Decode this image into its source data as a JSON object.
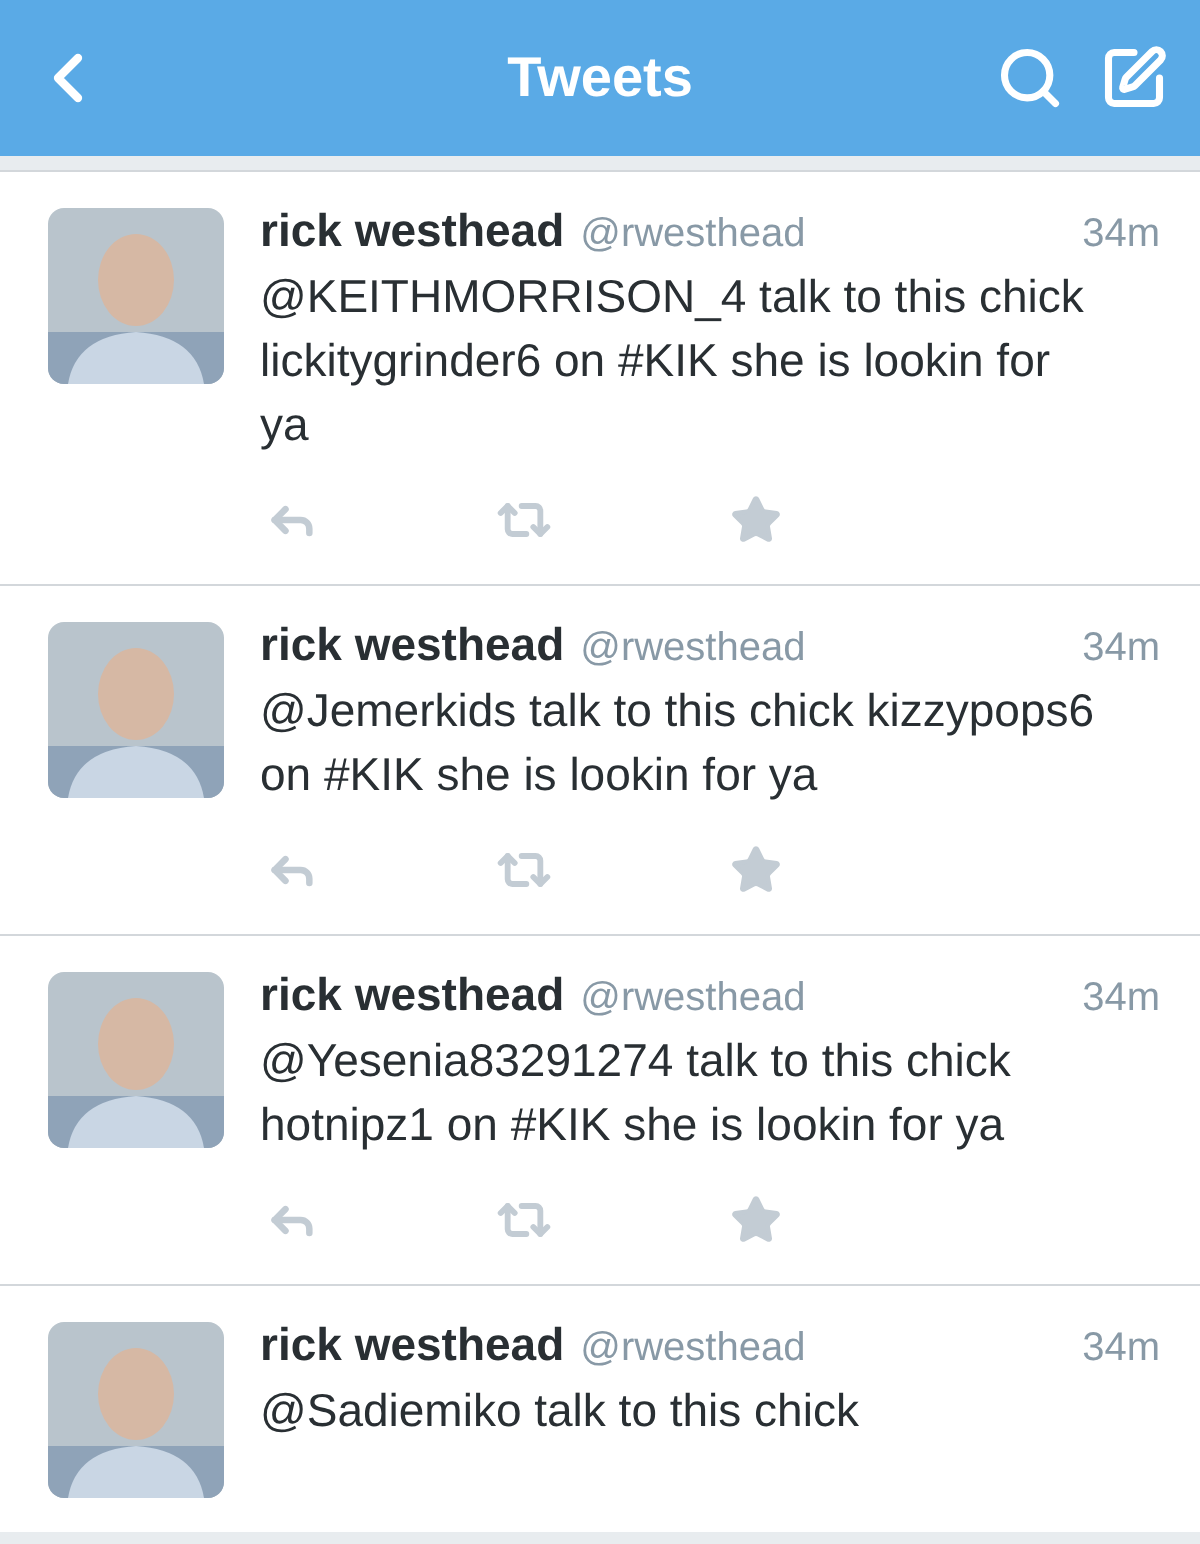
{
  "header": {
    "title": "Tweets"
  },
  "tweets": [
    {
      "name": "rick westhead",
      "handle": "@rwesthead",
      "time": "34m",
      "text": "@KEITHMORRISON_4 talk to this chick lickitygrinder6 on #KIK she is lookin for ya",
      "show_actions": true
    },
    {
      "name": "rick westhead",
      "handle": "@rwesthead",
      "time": "34m",
      "text": "@Jemerkids talk to this chick kizzypops6 on #KIK she is lookin for ya",
      "show_actions": true
    },
    {
      "name": "rick westhead",
      "handle": "@rwesthead",
      "time": "34m",
      "text": "@Yesenia83291274 talk to this chick hotnipz1 on #KIK she is lookin for ya",
      "show_actions": true
    },
    {
      "name": "rick westhead",
      "handle": "@rwesthead",
      "time": "34m",
      "text": "@Sadiemiko talk to this chick",
      "show_actions": false
    }
  ]
}
